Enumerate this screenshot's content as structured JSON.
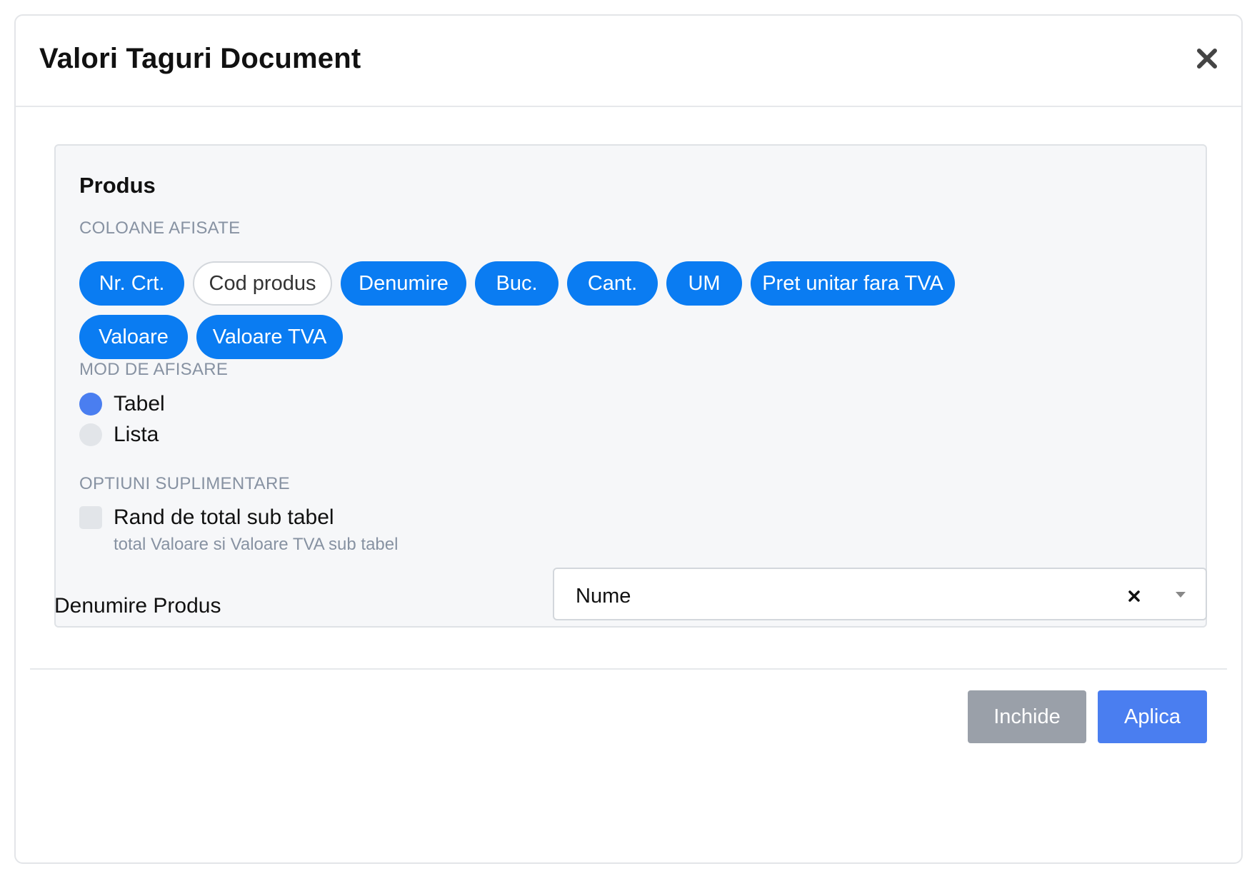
{
  "dialog": {
    "title": "Valori Taguri Document"
  },
  "product_section": {
    "title": "Produs",
    "columns_label": "COLOANE AFISATE",
    "columns": [
      {
        "label": "Nr. Crt.",
        "selected": true
      },
      {
        "label": "Cod produs",
        "selected": false
      },
      {
        "label": "Denumire",
        "selected": true
      },
      {
        "label": "Buc.",
        "selected": true
      },
      {
        "label": "Cant.",
        "selected": true
      },
      {
        "label": "UM",
        "selected": true
      },
      {
        "label": "Pret unitar fara TVA",
        "selected": true
      },
      {
        "label": "Valoare",
        "selected": true
      },
      {
        "label": "Valoare TVA",
        "selected": true
      }
    ],
    "display_mode_label": "MOD DE AFISARE",
    "display_modes": [
      {
        "label": "Tabel",
        "checked": true
      },
      {
        "label": "Lista",
        "checked": false
      }
    ],
    "extra_options_label": "OPTIUNI SUPLIMENTARE",
    "total_row": {
      "label": "Rand de total sub tabel",
      "hint": "total Valoare si Valoare TVA sub tabel",
      "checked": false
    }
  },
  "product_name_field": {
    "label": "Denumire Produs",
    "value": "Nume"
  },
  "footer": {
    "close_label": "Inchide",
    "apply_label": "Aplica"
  },
  "colors": {
    "chip_selected": "#0a7cf2",
    "radio_checked": "#4a7ef0",
    "apply_button": "#4a7ef0",
    "close_button": "#9aa0a9"
  }
}
